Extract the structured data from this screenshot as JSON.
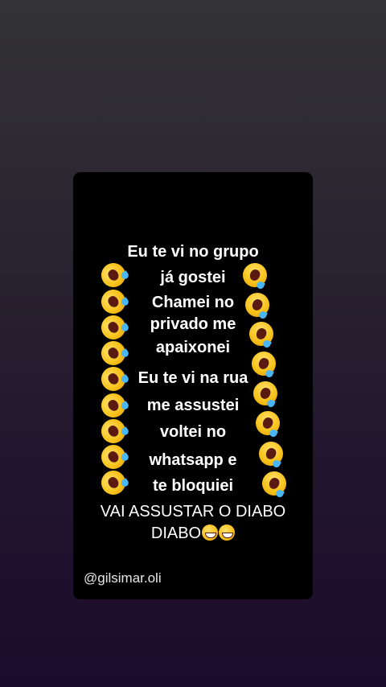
{
  "poem": {
    "lines": [
      "Eu te vi no grupo",
      "já gostei",
      "Chamei no",
      "privado me",
      "apaixonei",
      "Eu  te vi na rua",
      "me assustei",
      "voltei no",
      "whatsapp e",
      "te bloquiei"
    ],
    "closing_line_1": "VAI ASSUSTAR O DIABO",
    "closing_line_2": "DIABO"
  },
  "watermark": "@gilsimar.oli",
  "icons": {
    "left_column": "rolling-on-floor-laughing-icon",
    "right_column": "laughing-with-tears-icon",
    "end_emojis": [
      "grinning-face-icon",
      "grinning-sweat-icon"
    ]
  },
  "colors": {
    "card_background": "#000000",
    "text": "#ffffff",
    "emoji_yellow": "#f7c21a"
  }
}
